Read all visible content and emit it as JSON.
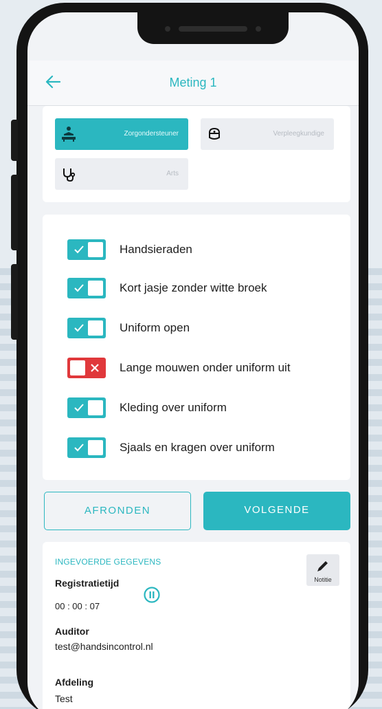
{
  "header": {
    "title": "Meting 1",
    "back_icon": "arrow-left-icon"
  },
  "roles": [
    {
      "label": "Zorgondersteuner",
      "icon": "caregiver-icon",
      "active": true
    },
    {
      "label": "Verpleegkundige",
      "icon": "nurse-cap-icon",
      "active": false
    },
    {
      "label": "Arts",
      "icon": "stethoscope-icon",
      "active": false
    }
  ],
  "checks": [
    {
      "label": "Handsieraden",
      "on": true
    },
    {
      "label": "Kort jasje zonder witte broek",
      "on": true
    },
    {
      "label": "Uniform open",
      "on": true
    },
    {
      "label": "Lange mouwen onder uniform uit",
      "on": false
    },
    {
      "label": "Kleding over uniform",
      "on": true
    },
    {
      "label": "Sjaals en kragen over uniform",
      "on": true
    }
  ],
  "actions": {
    "finish": "AFRONDEN",
    "next": "VOLGENDE"
  },
  "details": {
    "section_title": "INGEVOERDE GEGEVENS",
    "note_label": "Notitie",
    "registration_label": "Registratietijd",
    "registration_time": "00 : 00 : 07",
    "auditor_label": "Auditor",
    "auditor_value": "test@handsincontrol.nl",
    "department_label": "Afdeling",
    "department_value": "Test"
  },
  "colors": {
    "accent": "#2bb7c0",
    "error": "#e0383b"
  }
}
